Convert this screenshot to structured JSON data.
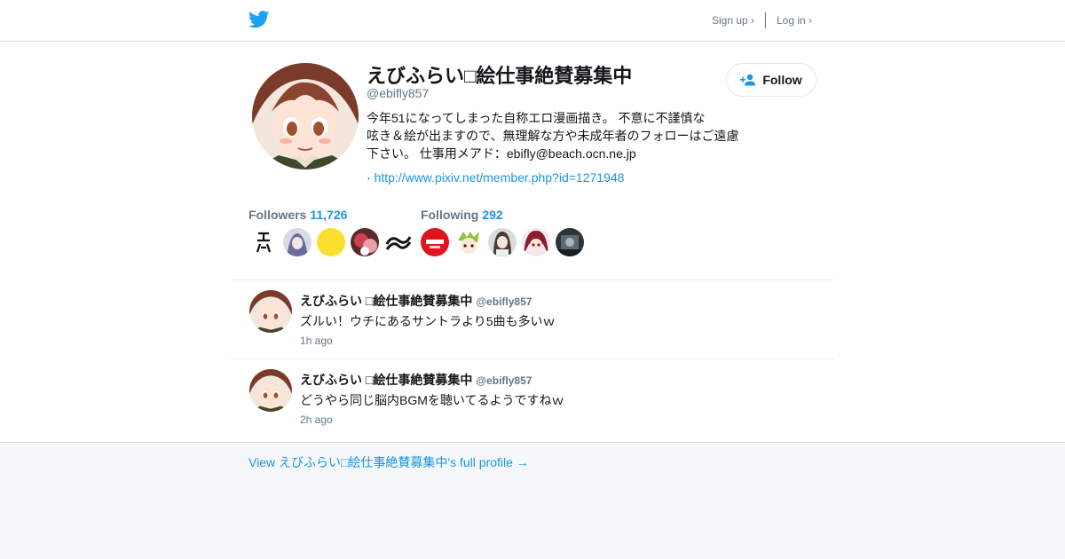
{
  "header": {
    "brand_icon": "twitter-bird-icon",
    "signup_label": "Sign up ›",
    "login_label": "Log in ›"
  },
  "profile": {
    "display_name": "えびふらい□絵仕事絶賛募集中",
    "handle": "@ebifly857",
    "follow_label": "Follow",
    "bio_lines": [
      "今年51になってしまった自称エロ漫画描き。 不意に不謹慎な",
      "呟き＆絵が出ますので、無理解な方や未成年者のフォローはご遠慮",
      "下さい。 仕事用メアド：ebifly@beach.ocn.ne.jp"
    ],
    "url_bullet": "·",
    "url": "http://www.pixiv.net/member.php?id=1271948"
  },
  "stats": {
    "followers_label": "Followers",
    "followers_count": "11,726",
    "following_label": "Following",
    "following_count": "292"
  },
  "tweets": [
    {
      "name": "えびふらい □絵仕事絶賛募集中",
      "handle": "@ebifly857",
      "text": "ズルい！ウチにあるサントラより5曲も多いｗ",
      "time": "1h ago"
    },
    {
      "name": "えびふらい □絵仕事絶賛募集中",
      "handle": "@ebifly857",
      "text": "どうやら同じ脳内BGMを聴いてるようですねｗ",
      "time": "2h ago"
    }
  ],
  "footer": {
    "full_profile_link": "View えびふらい□絵仕事絶賛募集中's full profile →"
  },
  "colors": {
    "accent": "#1b95e0",
    "brand": "#1da1f2",
    "muted": "#657786",
    "footer_bg": "#f5f8fa"
  }
}
